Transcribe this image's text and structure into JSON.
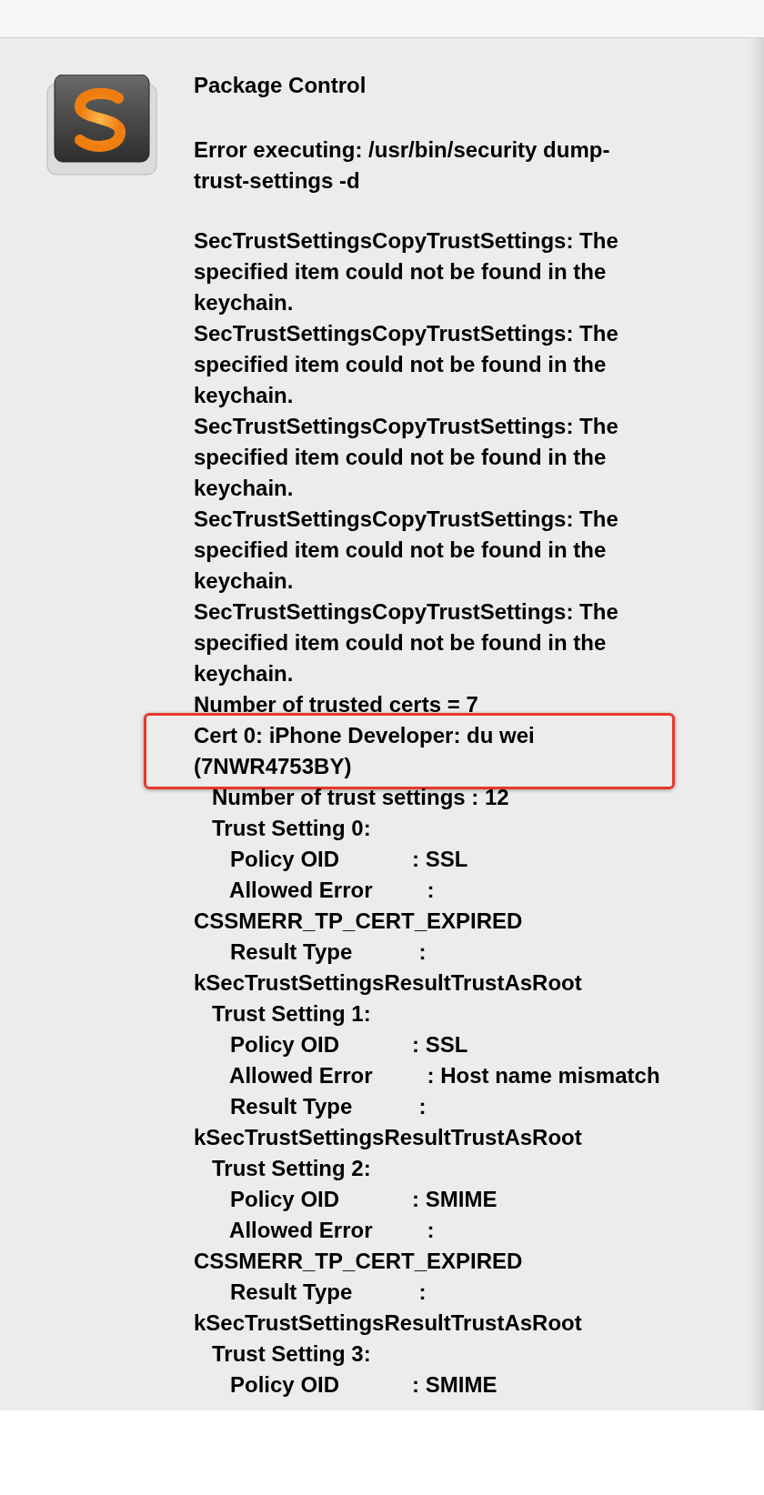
{
  "dialog": {
    "title": "Package Control",
    "error_lines": [
      "Error executing: /usr/bin/security dump-",
      "trust-settings -d"
    ],
    "blocks": [
      {
        "kind": "text",
        "lines": [
          "SecTrustSettingsCopyTrustSettings: The",
          "specified item could not be found in the",
          "keychain.",
          "SecTrustSettingsCopyTrustSettings: The",
          "specified item could not be found in the",
          "keychain.",
          "SecTrustSettingsCopyTrustSettings: The",
          "specified item could not be found in the",
          "keychain.",
          "SecTrustSettingsCopyTrustSettings: The",
          "specified item could not be found in the",
          "keychain.",
          "SecTrustSettingsCopyTrustSettings: The",
          "specified item could not be found in the",
          "keychain.",
          "Number of trusted certs = 7"
        ]
      },
      {
        "kind": "highlight",
        "lines": [
          "Cert 0: iPhone Developer: du wei",
          "(7NWR4753BY)"
        ]
      },
      {
        "kind": "text",
        "lines": [
          "   Number of trust settings : 12",
          "   Trust Setting 0:",
          "      Policy OID            : SSL",
          "      Allowed Error         :",
          "CSSMERR_TP_CERT_EXPIRED",
          "      Result Type           :",
          "kSecTrustSettingsResultTrustAsRoot",
          "   Trust Setting 1:",
          "      Policy OID            : SSL",
          "      Allowed Error         : Host name mismatch",
          "      Result Type           :",
          "kSecTrustSettingsResultTrustAsRoot",
          "   Trust Setting 2:",
          "      Policy OID            : SMIME",
          "      Allowed Error         :",
          "CSSMERR_TP_CERT_EXPIRED",
          "      Result Type           :",
          "kSecTrustSettingsResultTrustAsRoot",
          "   Trust Setting 3:",
          "      Policy OID            : SMIME"
        ]
      }
    ]
  }
}
